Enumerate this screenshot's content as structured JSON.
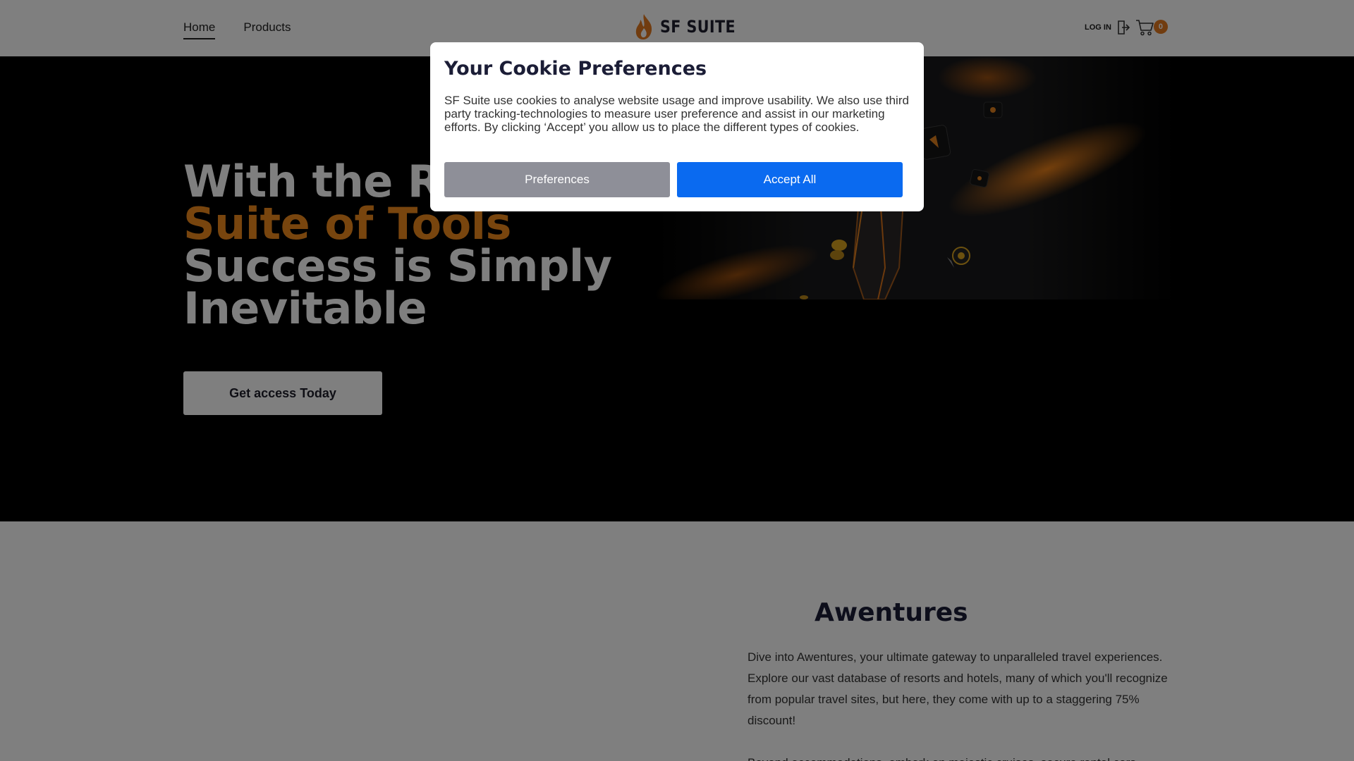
{
  "header": {
    "nav": [
      {
        "label": "Home",
        "active": true
      },
      {
        "label": "Products",
        "active": false
      }
    ],
    "logo_text": "SF SUITE",
    "login_label": "LOG IN",
    "cart_count": "0"
  },
  "hero": {
    "line1": "With the Ri",
    "line2": "Suite of Tools",
    "line3": "Success is Simply",
    "line4": "Inevitable",
    "cta_label": "Get access Today"
  },
  "section": {
    "title": "Awentures",
    "paragraph1": "Dive into Awentures, your ultimate gateway to unparalleled travel experiences. Explore our vast database of resorts and hotels, many of which you'll recognize from popular travel sites, but here, they come with up to a staggering 75% discount!",
    "paragraph2": "Beyond accommodations, embark on majestic cruises, secure rental cars"
  },
  "cookie_modal": {
    "title": "Your Cookie Preferences",
    "text": "SF Suite use cookies to analyse website usage and improve usability. We also use third party tracking-technologies to measure user preference and assist in our marketing efforts. By clicking ‘Accept’ you allow us to place the different types of cookies.",
    "preferences_label": "Preferences",
    "accept_label": "Accept All"
  },
  "colors": {
    "accent_orange": "#f08a1c",
    "accept_blue": "#0a6af0",
    "preferences_gray": "#8e8f98",
    "title_navy": "#1b1d36"
  }
}
